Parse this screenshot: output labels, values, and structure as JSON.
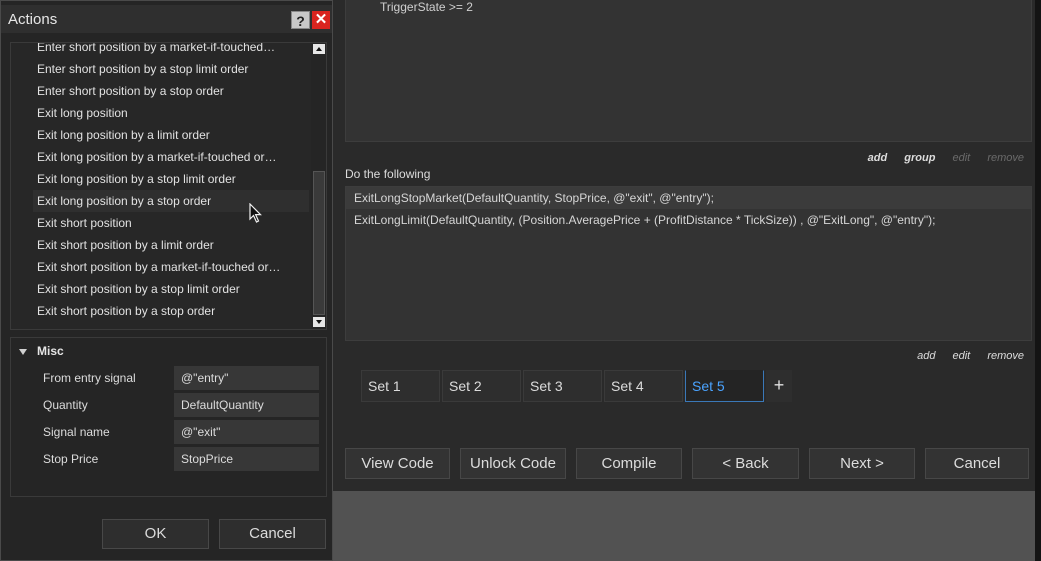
{
  "dialog": {
    "title": "Actions",
    "help_label": "?",
    "close_label": "✕",
    "actions_list": [
      "Enter short position by a market-if-touched…",
      "Enter short position by a stop limit order",
      "Enter short position by a stop order",
      "Exit long position",
      "Exit long position by a limit order",
      "Exit long position by a market-if-touched or…",
      "Exit long position by a stop limit order",
      "Exit long position by a stop order",
      "Exit short position",
      "Exit short position by a limit order",
      "Exit short position by a market-if-touched or…",
      "Exit short position by a stop limit order",
      "Exit short position by a stop order"
    ],
    "properties": {
      "section": "Misc",
      "rows": [
        {
          "label": "From entry signal",
          "value": "@\"entry\""
        },
        {
          "label": "Quantity",
          "value": "DefaultQuantity"
        },
        {
          "label": "Signal name",
          "value": "@\"exit\""
        },
        {
          "label": "Stop Price",
          "value": "StopPrice"
        }
      ]
    },
    "ok_label": "OK",
    "cancel_label": "Cancel"
  },
  "main": {
    "condition_code": "TriggerState >= 2",
    "condition_links": {
      "add": "add",
      "group": "group",
      "edit": "edit",
      "remove": "remove"
    },
    "do_label": "Do the following",
    "actions_code": [
      "ExitLongStopMarket(DefaultQuantity, StopPrice, @\"exit\", @\"entry\");",
      "ExitLongLimit(DefaultQuantity, (Position.AveragePrice + (ProfitDistance * TickSize)) , @\"ExitLong\", @\"entry\");"
    ],
    "action_links": {
      "add": "add",
      "edit": "edit",
      "remove": "remove"
    },
    "sets": [
      "Set 1",
      "Set 2",
      "Set 3",
      "Set 4",
      "Set 5"
    ],
    "active_set": "Set 5",
    "add_set_label": "+",
    "buttons": {
      "view_code": "View Code",
      "unlock_code": "Unlock Code",
      "compile": "Compile",
      "back": "< Back",
      "next": "Next >",
      "cancel": "Cancel"
    }
  },
  "colors": {
    "background": "#2a2a2a",
    "active_tab_text": "#4aa3ff",
    "close_button": "#d9241f"
  }
}
